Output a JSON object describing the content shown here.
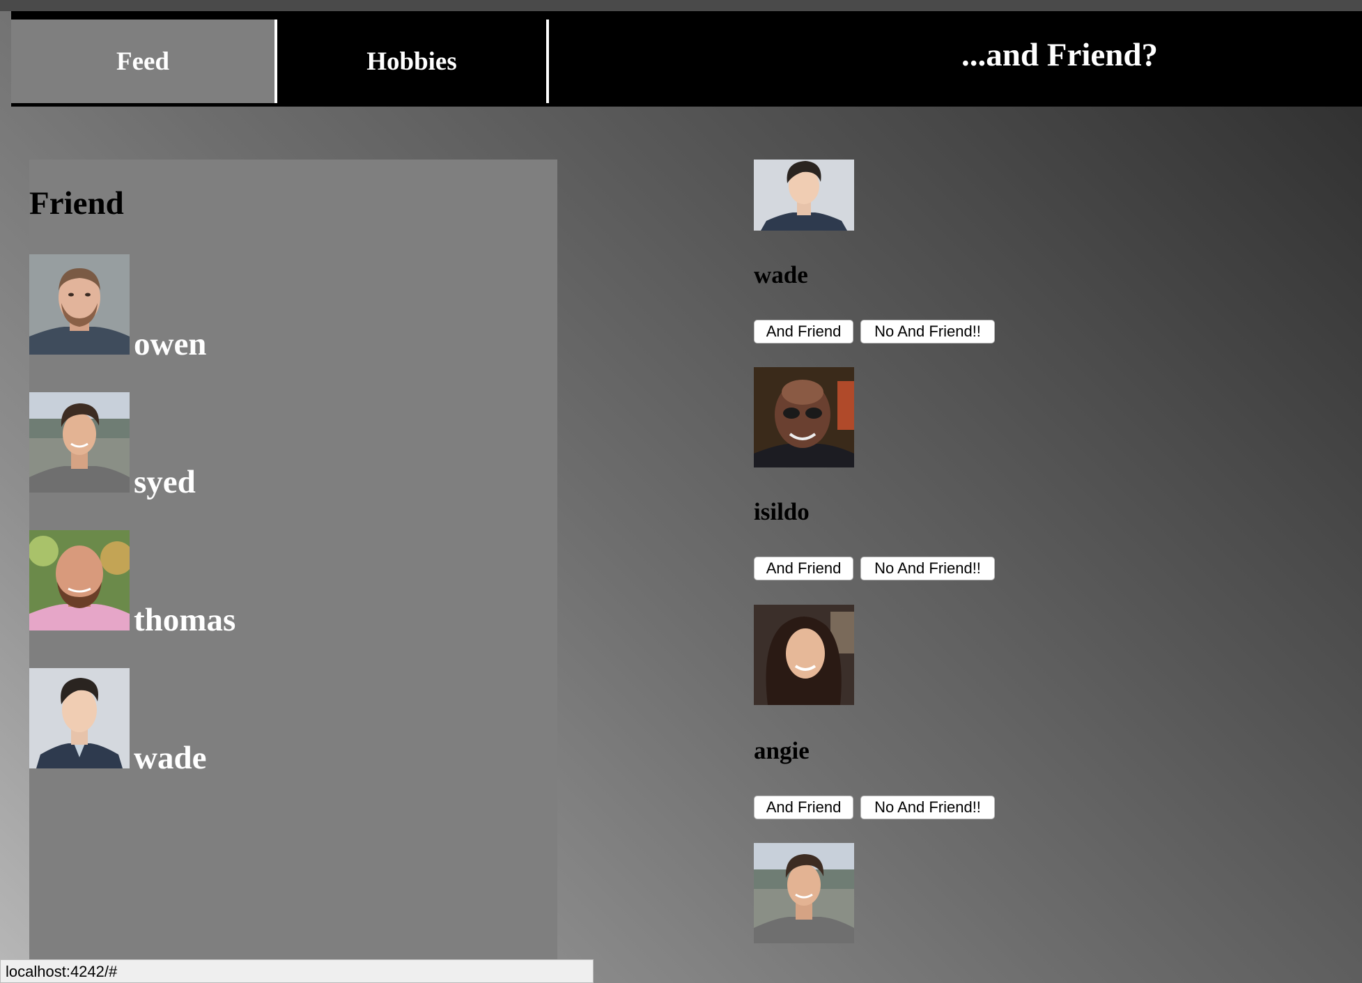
{
  "nav": {
    "tabs": [
      {
        "label": "Feed",
        "active": true
      },
      {
        "label": "Hobbies",
        "active": false
      }
    ],
    "brand": "...and Friend?"
  },
  "friends": {
    "title": "Friend",
    "items": [
      {
        "name": "owen",
        "avatar": "bearded-man-photo"
      },
      {
        "name": "syed",
        "avatar": "young-man-outdoors-photo"
      },
      {
        "name": "thomas",
        "avatar": "bald-bearded-man-photo"
      },
      {
        "name": "wade",
        "avatar": "young-man-suit-photo"
      }
    ]
  },
  "suggestions": [
    {
      "name": "wade",
      "avatar": "young-man-suit-photo",
      "and_label": "And Friend",
      "no_label": "No And Friend!!"
    },
    {
      "name": "isildo",
      "avatar": "man-sunglasses-photo",
      "and_label": "And Friend",
      "no_label": "No And Friend!!"
    },
    {
      "name": "angie",
      "avatar": "smiling-woman-photo",
      "and_label": "And Friend",
      "no_label": "No And Friend!!"
    },
    {
      "name": "",
      "avatar": "young-man-outdoors-photo"
    }
  ],
  "status_bar": {
    "url": "localhost:4242/#"
  },
  "colors": {
    "navbar": "#000000",
    "active_tab": "#7f7f7f",
    "panel": "#7f7f7f",
    "button_bg": "#ffffff"
  }
}
